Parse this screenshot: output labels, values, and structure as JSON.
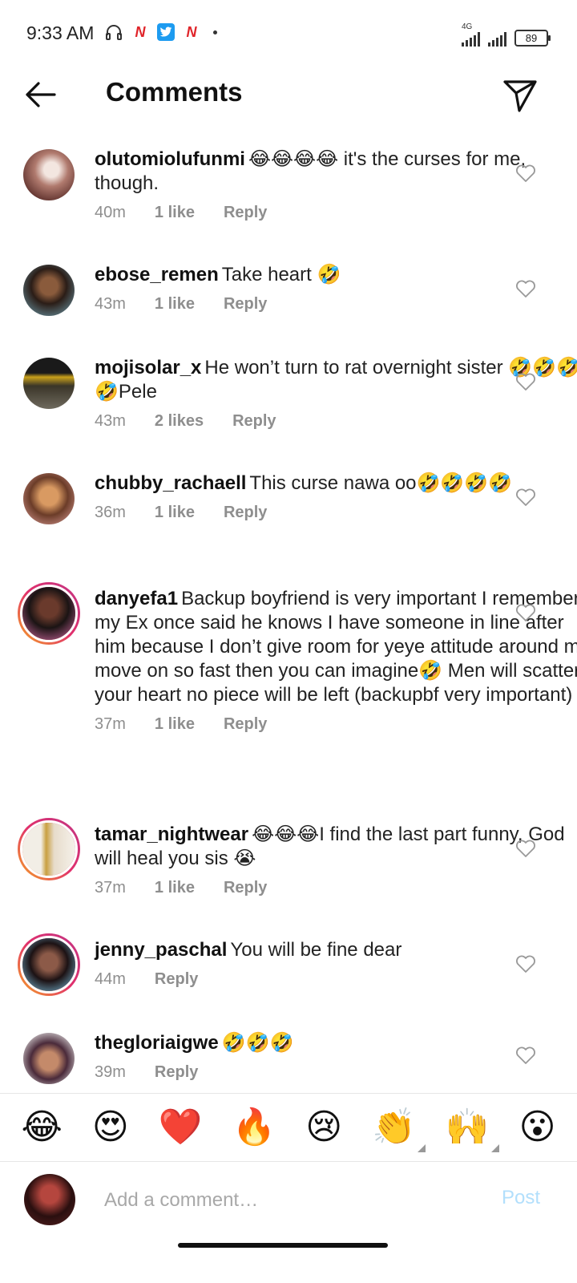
{
  "status": {
    "time": "9:33 AM",
    "network": "4G",
    "battery": "89",
    "left_icons": [
      "headphones-icon",
      "n-app-icon",
      "twitter-icon",
      "n-app-icon",
      "dot-icon"
    ]
  },
  "header": {
    "title": "Comments",
    "back_icon": "arrow-left-icon",
    "send_icon": "paper-plane-icon"
  },
  "comments": [
    {
      "username": "olutomiolufunmi",
      "text": "😂😂😂😂 it's the curses for me, though.",
      "time": "40m",
      "likes": "1 like",
      "reply": "Reply",
      "story_ring": false
    },
    {
      "username": "ebose_remen",
      "text": "Take heart 🤣",
      "time": "43m",
      "likes": "1 like",
      "reply": "Reply",
      "story_ring": false
    },
    {
      "username": "mojisolar_x",
      "text": "He won’t turn to rat overnight sister 🤣🤣🤣🤣Pele",
      "time": "43m",
      "likes": "2 likes",
      "reply": "Reply",
      "story_ring": false
    },
    {
      "username": "chubby_rachaell",
      "text": "This curse nawa oo🤣🤣🤣🤣",
      "time": "36m",
      "likes": "1 like",
      "reply": "Reply",
      "story_ring": false
    },
    {
      "username": "danyefa1",
      "text": "Backup boyfriend is very important I remember my Ex once said he knows I have someone in line after him because I don’t give room for yeye attitude around me move on so fast then you can imagine🤣 Men will scatter your heart no piece will be left (backupbf very important)",
      "time": "37m",
      "likes": "1 like",
      "reply": "Reply",
      "story_ring": true
    },
    {
      "username": "tamar_nightwear",
      "text": "😂😂😂I find the last part funny, God will heal you sis 😭",
      "time": "37m",
      "likes": "1 like",
      "reply": "Reply",
      "story_ring": true
    },
    {
      "username": "jenny_paschal",
      "text": "You will be fine dear",
      "time": "44m",
      "likes": "",
      "reply": "Reply",
      "story_ring": true
    },
    {
      "username": "thegloriaigwe",
      "text": "🤣🤣🤣",
      "time": "39m",
      "likes": "",
      "reply": "Reply",
      "story_ring": false
    }
  ],
  "emoji_bar": [
    "😂",
    "😍",
    "❤️",
    "🔥",
    "😢",
    "👏",
    "🙌",
    "😮"
  ],
  "composer": {
    "placeholder": "Add a comment…",
    "post_label": "Post"
  },
  "colors": {
    "accent_disabled": "#b2dffc",
    "meta": "#8e8e8e",
    "story_ring": "#e1306c"
  }
}
